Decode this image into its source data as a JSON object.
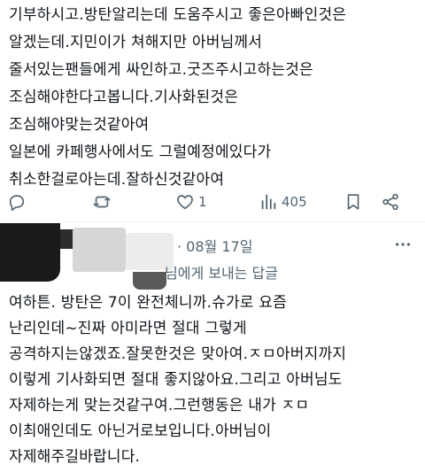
{
  "post": {
    "lines": [
      "기부하시고.방탄알리는데 도움주시고 좋은아빠인것은",
      "알겠는데.지민이가 쳐해지만 아버님께서",
      "줄서있는팬들에게 싸인하고.굿즈주시고하는것은",
      "조심해야한다고봅니다.기사화된것은",
      "조심해야맞는것같아여",
      "일본에 카페행사에서도 그럴예정에있다가",
      "취소한걸로아는데.잘하신것같아여"
    ],
    "actions": {
      "reply_icon": "reply-icon",
      "retweet_icon": "retweet-icon",
      "like_icon": "heart-icon",
      "like_count": "1",
      "views_icon": "views-icon",
      "views_count": "405",
      "bookmark_icon": "bookmark-icon",
      "share_icon": "share-icon"
    }
  },
  "reply": {
    "date": "· 08월 17일",
    "reply_to": "님에게 보내는 답글",
    "more_icon": "more-icon",
    "lines": [
      "여하튼. 방탄은 7이 완전체니까.슈가로 요즘",
      "난리인데~진짜 아미라면 절대 그렇게",
      "공격하지는않겠죠.잘못한것은 맞아여.ㅈㅁ아버지까지",
      "이렇게 기사화되면 절대 좋지않아요.그리고 아버님도",
      "자제하는게 맞는것같구여.그런행동은 내가 ㅈㅁ",
      "이최애인데도 아닌거로보입니다.아버님이",
      "자제해주길바랍니다."
    ]
  }
}
